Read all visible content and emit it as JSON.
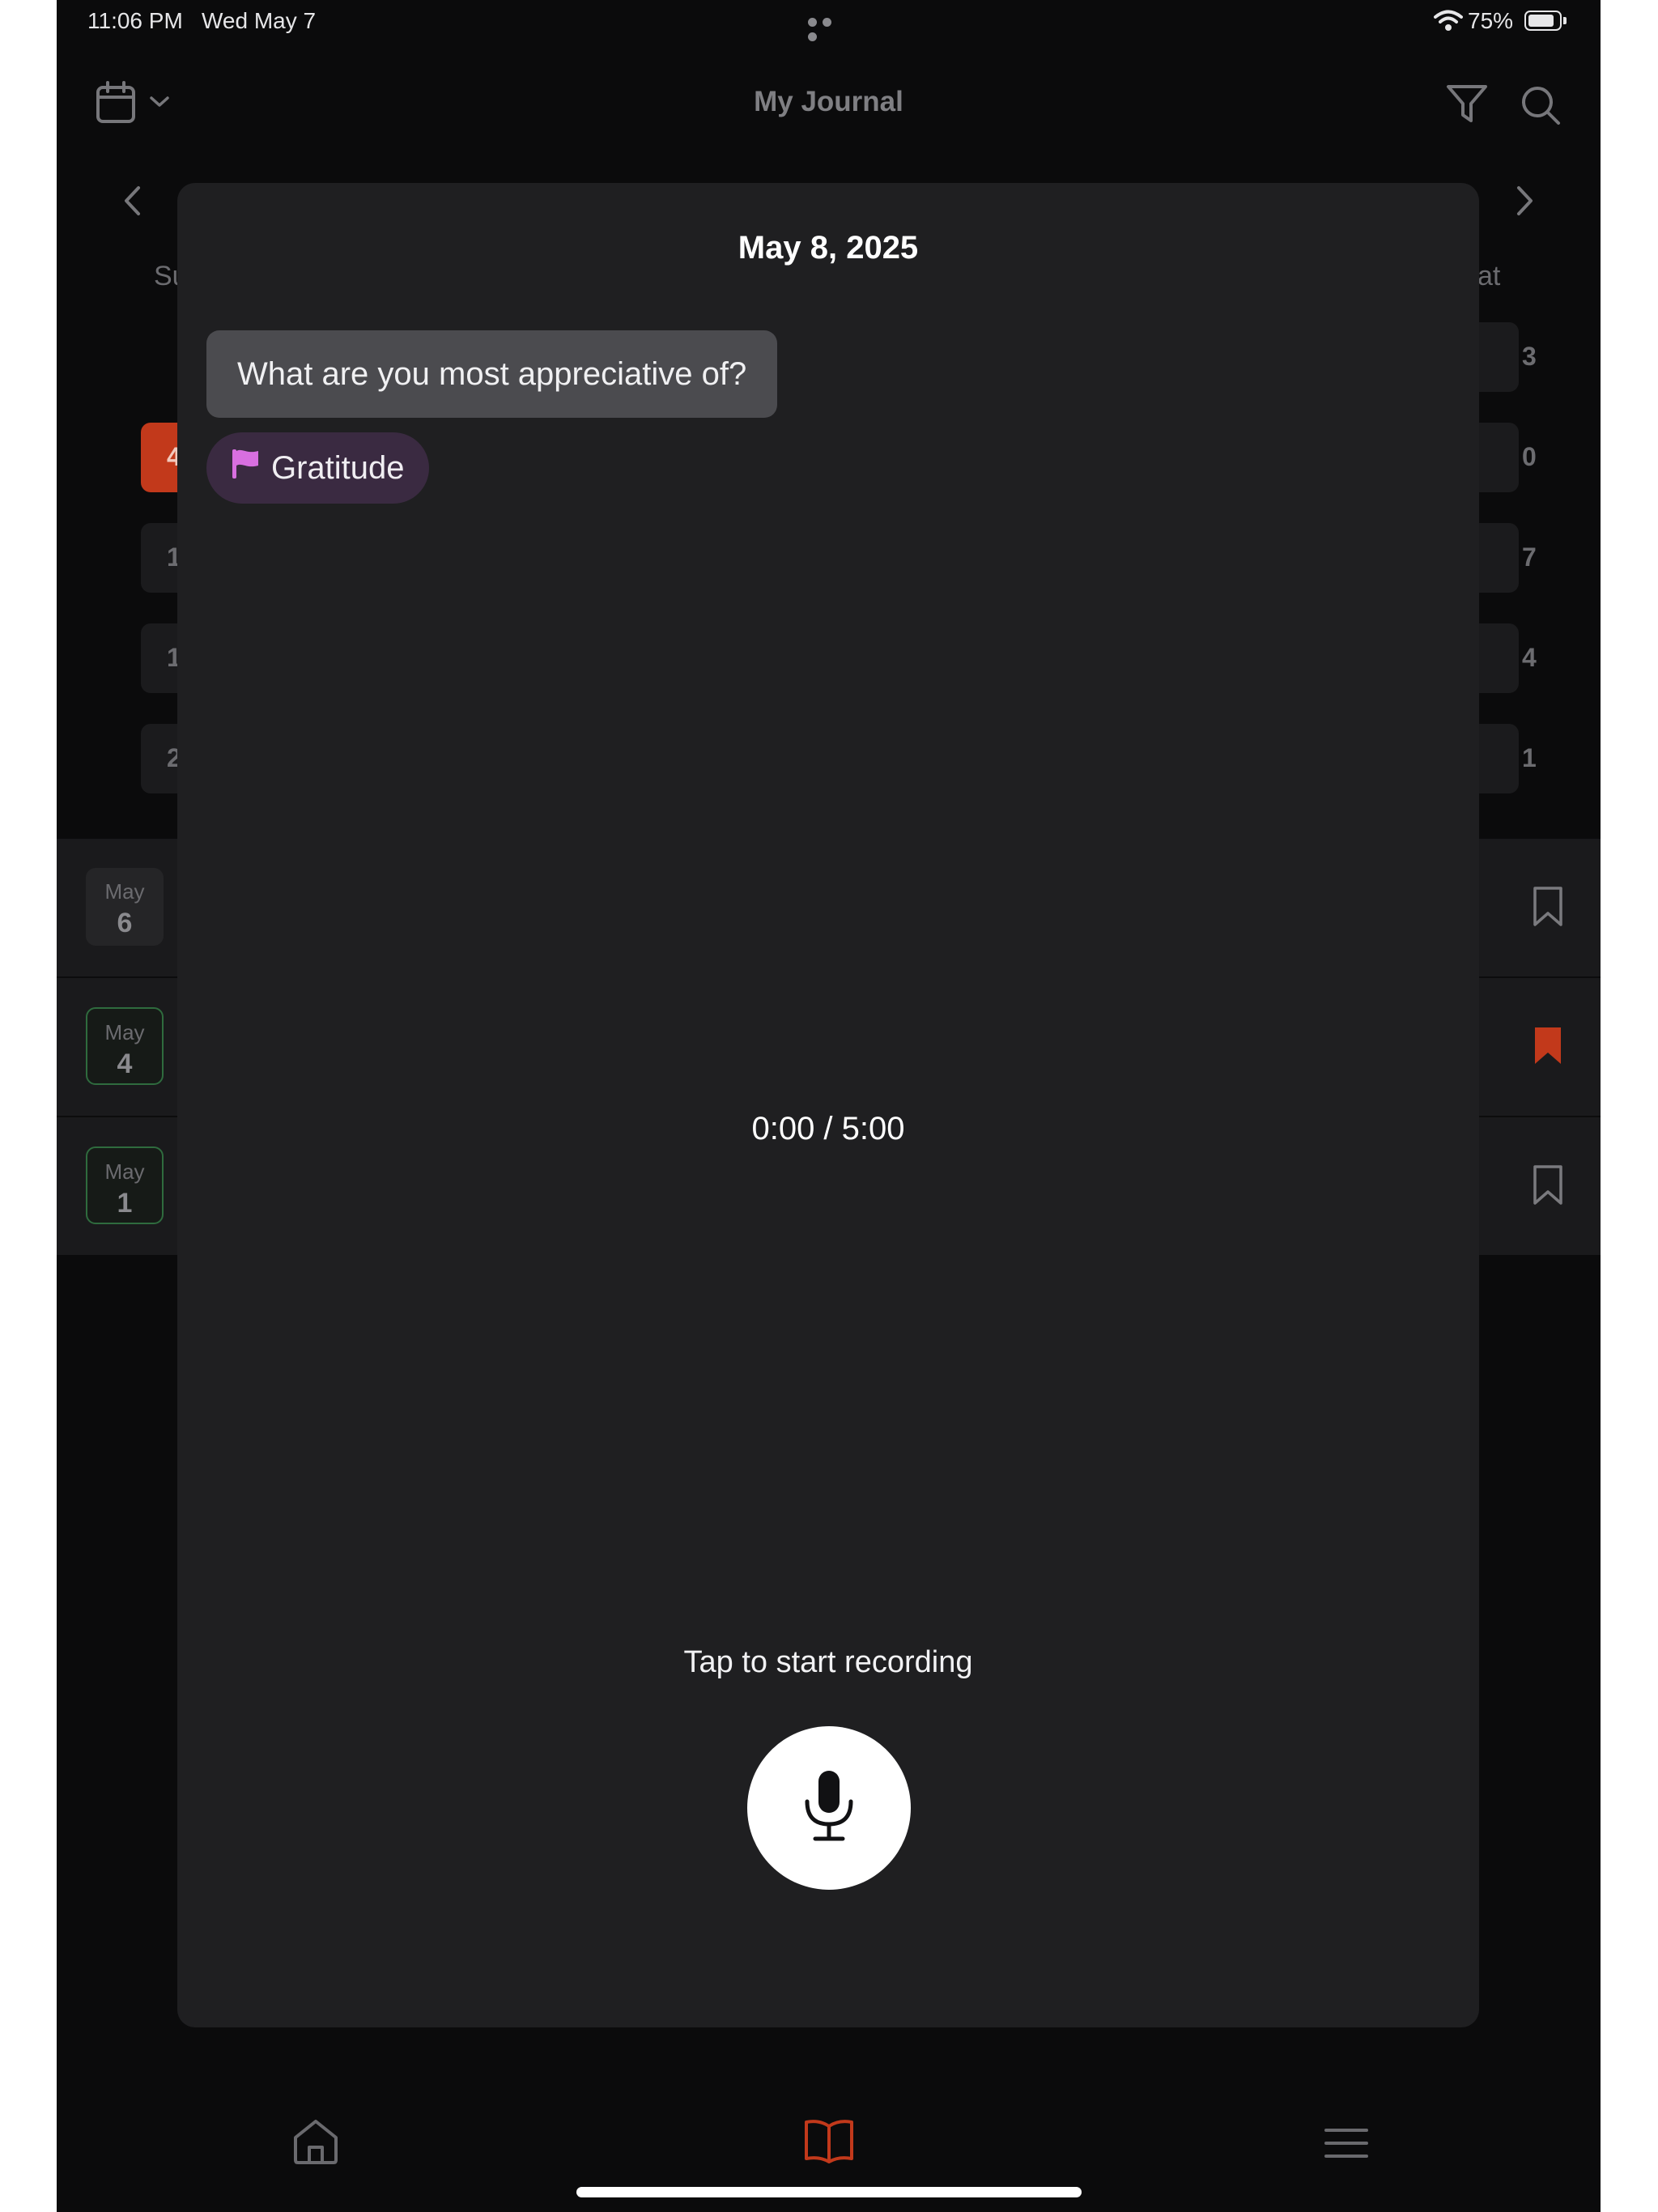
{
  "status_bar": {
    "time": "11:06 PM",
    "date": "Wed May 7",
    "battery_percent": "75%",
    "battery_level": 0.75
  },
  "header": {
    "title": "My Journal"
  },
  "calendar_bg": {
    "weekday_left": "Su",
    "weekday_right": "at",
    "left_days": [
      "",
      "4",
      "1",
      "1",
      "2"
    ],
    "right_days": [
      "3",
      "0",
      "7",
      "4",
      "1"
    ]
  },
  "entries_bg": [
    {
      "month": "May",
      "day": "6",
      "bookmarked": false
    },
    {
      "month": "May",
      "day": "4",
      "bookmarked": true
    },
    {
      "month": "May",
      "day": "1",
      "bookmarked": false
    }
  ],
  "modal": {
    "date": "May 8, 2025",
    "prompt": "What are you most appreciative of?",
    "tag": "Gratitude",
    "timer": "0:00 / 5:00",
    "hint": "Tap to start recording"
  },
  "colors": {
    "accent": "#c2391b",
    "tag_flag": "#d86fe0",
    "tag_bg": "#3a2a41",
    "modal_bg": "#1f1f21",
    "entry_border_green": "#2f6b3e"
  },
  "tab_bar": {
    "items": [
      "home-icon",
      "journal-book-icon",
      "menu-icon"
    ],
    "active": "journal-book-icon"
  }
}
